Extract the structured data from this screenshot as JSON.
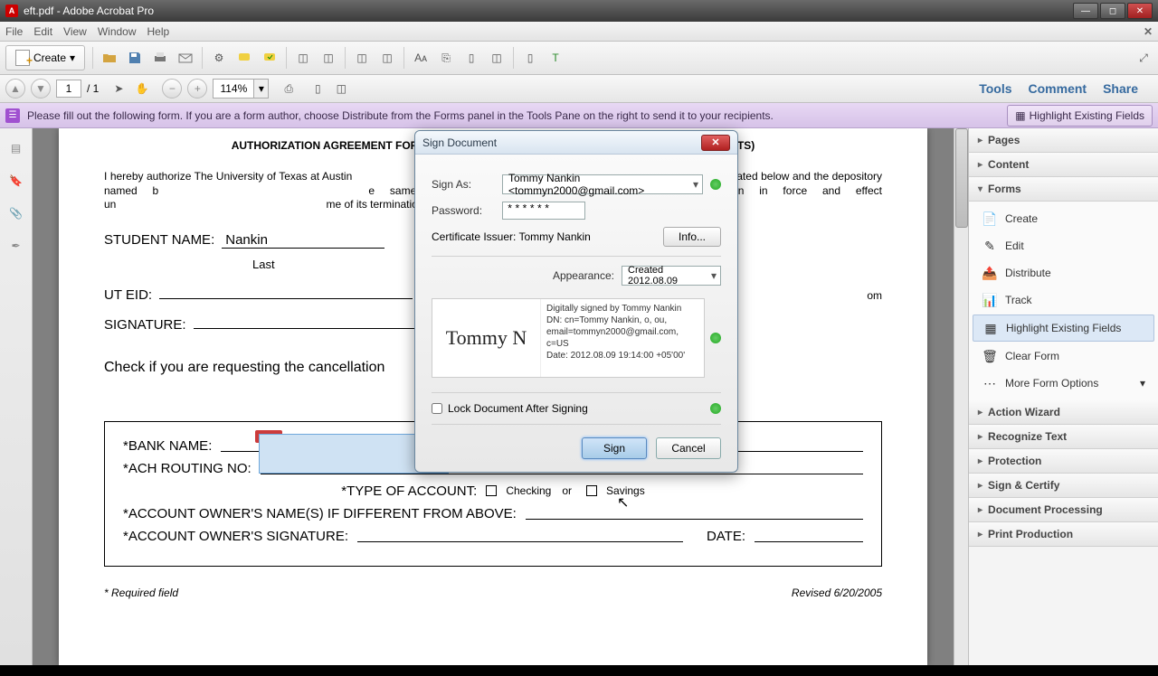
{
  "window": {
    "title": "eft.pdf - Adobe Acrobat Pro"
  },
  "menus": [
    "File",
    "Edit",
    "View",
    "Window",
    "Help"
  ],
  "toolbar1": {
    "create": "Create"
  },
  "toolbar2": {
    "page_current": "1",
    "page_total": "/ 1",
    "zoom": "114%"
  },
  "right_tabs": [
    "Tools",
    "Comment",
    "Share"
  ],
  "form_bar": {
    "msg": "Please fill out the following form. If you are a form author, choose Distribute from the Forms panel in the Tools Pane on the right to send it to your recipients.",
    "highlight_btn": "Highlight Existing Fields"
  },
  "document": {
    "title_left": "AUTHORIZATION AGREEMENT FOR A",
    "title_right": "ENTS (DEBITS)",
    "para1": "I hereby authorize The University of Texas at Austin",
    "para1_mid_a": "ebit entries from/to my account indicated below and the depository named b",
    "para1_mid_b": "e same to such account. This authorization is to remain in force and effect un",
    "para1_mid_c": "me of its termination in such time and in such manner as to afford UNIVERS",
    "student_name_label": "STUDENT NAME:",
    "student_last": "Nankin",
    "sub_last": "Last",
    "uteid_label": "UT EID:",
    "email_text": "om",
    "signature_label": "SIGNATURE:",
    "check_text": "Check if you are requesting the cancellation",
    "bank_name_label": "*BANK NAME:",
    "ach_label": "*ACH ROUTING NO:",
    "type_label": "*TYPE OF ACCOUNT:",
    "checking": "Checking",
    "or": "or",
    "savings": "Savings",
    "owner_label": "*ACCOUNT OWNER'S NAME(S) IF DIFFERENT FROM ABOVE:",
    "owner_sig_label": "*ACCOUNT OWNER'S SIGNATURE:",
    "date_label": "DATE:",
    "required": "* Required field",
    "revised": "Revised 6/20/2005"
  },
  "panel": {
    "sections": [
      "Pages",
      "Content",
      "Forms",
      "Action Wizard",
      "Recognize Text",
      "Protection",
      "Sign & Certify",
      "Document Processing",
      "Print Production"
    ],
    "forms_items": [
      {
        "icon": "📄",
        "label": "Create"
      },
      {
        "icon": "✎",
        "label": "Edit"
      },
      {
        "icon": "📤",
        "label": "Distribute"
      },
      {
        "icon": "📊",
        "label": "Track"
      },
      {
        "icon": "▦",
        "label": "Highlight Existing Fields",
        "active": true
      },
      {
        "icon": "🗑",
        "label": "Clear Form"
      },
      {
        "icon": "⋯",
        "label": "More Form Options"
      }
    ]
  },
  "dialog": {
    "title": "Sign Document",
    "sign_as_label": "Sign As:",
    "sign_as_value": "Tommy Nankin <tommyn2000@gmail.com>",
    "password_label": "Password:",
    "password_value": "******",
    "cert_issuer": "Certificate Issuer: Tommy Nankin",
    "info_btn": "Info...",
    "appearance_label": "Appearance:",
    "appearance_value": "Created 2012.08.09",
    "sig_name": "Tommy N",
    "sig_text": "Digitally signed by Tommy Nankin\nDN: cn=Tommy Nankin, o, ou, email=tommyn2000@gmail.com, c=US\nDate: 2012.08.09 19:14:00 +05'00'",
    "lock_label": "Lock Document After Signing",
    "sign_btn": "Sign",
    "cancel_btn": "Cancel"
  }
}
